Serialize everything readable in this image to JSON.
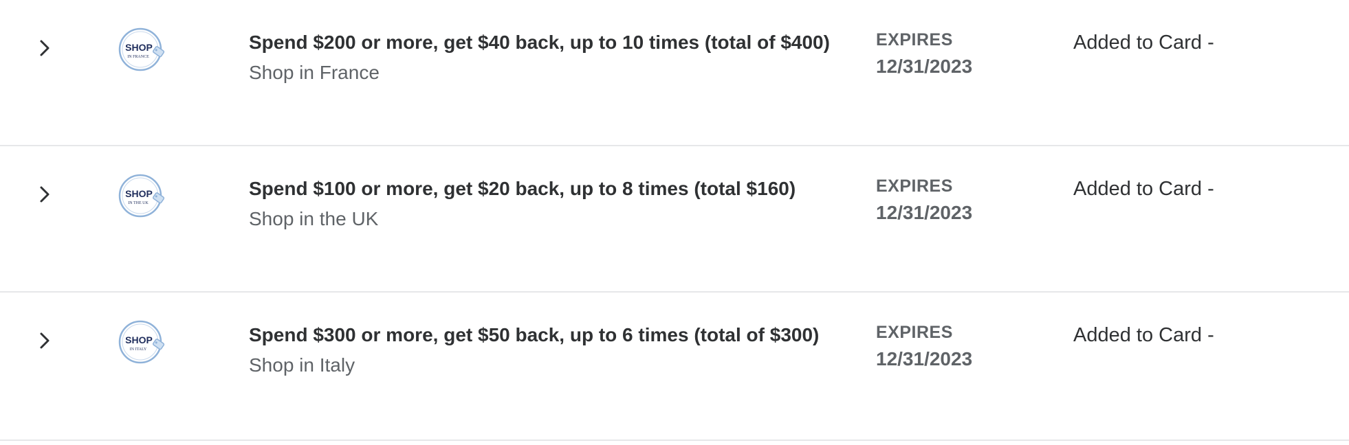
{
  "offers": [
    {
      "title": "Spend $200 or more, get $40 back, up to 10 times (total of $400)",
      "merchant": "Shop in France",
      "expires_label": "EXPIRES",
      "expires_date": "12/31/2023",
      "status": "Added to Card -",
      "logo": {
        "word": "SHOP",
        "subtitle": "IN FRANCE",
        "icon": "shop-tag-logo-icon"
      }
    },
    {
      "title": "Spend $100 or more, get $20 back, up to 8 times (total $160)",
      "merchant": "Shop in the UK",
      "expires_label": "EXPIRES",
      "expires_date": "12/31/2023",
      "status": "Added to Card -",
      "logo": {
        "word": "SHOP",
        "subtitle": "IN THE UK",
        "icon": "shop-tag-logo-icon"
      }
    },
    {
      "title": "Spend $300 or more, get $50 back, up to 6 times (total of $300)",
      "merchant": "Shop in Italy",
      "expires_label": "EXPIRES",
      "expires_date": "12/31/2023",
      "status": "Added to Card -",
      "logo": {
        "word": "SHOP",
        "subtitle": "IN ITALY",
        "icon": "shop-tag-logo-icon"
      }
    }
  ],
  "colors": {
    "title": "#2f3133",
    "secondary": "#5f6367",
    "divider": "#e6e7e9",
    "logo_ring": "#8fb2d9",
    "logo_text": "#1f2d5c"
  }
}
